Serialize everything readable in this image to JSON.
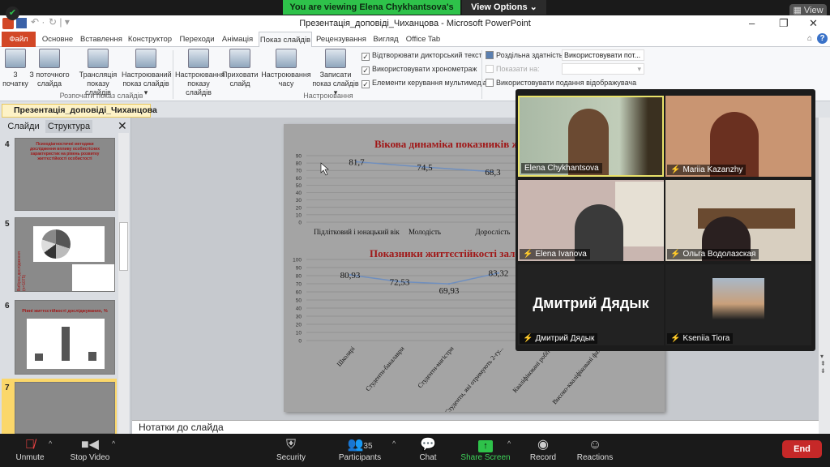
{
  "zoom": {
    "banner": "You are viewing Elena Chykhantsova's screen",
    "view_options": "View Options ⌄",
    "view": "View",
    "toolbar": {
      "unmute": "Unmute",
      "stop_video": "Stop Video",
      "security": "Security",
      "participants": "Participants",
      "participants_count": "35",
      "chat": "Chat",
      "share_screen": "Share Screen",
      "record": "Record",
      "reactions": "Reactions",
      "end": "End"
    },
    "participants": [
      {
        "name": "Elena Chykhantsova",
        "muted": false,
        "color": "#a9b9a5"
      },
      {
        "name": "Mariia Kazanzhy",
        "muted": true,
        "color": "#c99572"
      },
      {
        "name": "Elena Ivanova",
        "muted": true,
        "color": "#c9b6b0"
      },
      {
        "name": "Ольга Водолазская",
        "muted": true,
        "color": "#d8cfc0"
      },
      {
        "name": "Дмитрий Дядык",
        "muted": true,
        "big_name": "Дмитрий Дядык"
      },
      {
        "name": "Kseniia Tiora",
        "muted": true
      }
    ]
  },
  "ppt": {
    "title": "Презентація_доповіді_Чиханцова - Microsoft PowerPoint",
    "tabs": [
      "Файл",
      "Основне",
      "Вставлення",
      "Конструктор",
      "Переходи",
      "Анімація",
      "Показ слайдів",
      "Рецензування",
      "Вигляд",
      "Office Tab"
    ],
    "ribbon": {
      "buttons": [
        "3 початку",
        "З поточного слайда",
        "Трансляція показу слайдів",
        "Настроюваний показ слайдів ▾",
        "Настроювання показу слайдів",
        "Приховати слайд",
        "Настроювання часу",
        "Записати показ слайдів ▾"
      ],
      "groups": [
        "Розпочати показ слайдів",
        "Настроювання"
      ],
      "checks": [
        "Відтворювати дикторський текст",
        "Використовувати хронометраж",
        "Елементи керування мультимедіа"
      ],
      "resolution_label": "Роздільна здатність:",
      "resolution_value": "Використовувати пот...",
      "show_on_label": "Показати на:",
      "presenter_view": "Використовувати подання відображувача"
    },
    "doc_tab": "Презентація_доповіді_Чиханцова",
    "pane_tabs": [
      "Слайди",
      "Структура"
    ],
    "slide_numbers": [
      "4",
      "5",
      "6",
      "7"
    ],
    "thumb_titles": [
      "Психодіагностичні методики дослідження впливу особистісних характеристик на рівень розвитку життєстійкості особистості",
      "Вибірка дослідження (n=1075)",
      "Рівні життєстійкості досліджуваних, %"
    ],
    "notes": "Нотатки до слайда"
  },
  "chart_data": [
    {
      "type": "line",
      "title": "Вікова динаміка показників ж",
      "categories": [
        "Підлітковий і юнацький вік",
        "Молодість",
        "Дорослість"
      ],
      "values": [
        81.7,
        74.5,
        68.3
      ],
      "labels": [
        "81,7",
        "74,5",
        "68,3"
      ],
      "ylim": [
        0,
        90
      ],
      "yticks": [
        0,
        10,
        20,
        30,
        40,
        50,
        60,
        70,
        80,
        90
      ],
      "color": "#6f8fbf"
    },
    {
      "type": "line",
      "title": "Показники життєстійкості залежн",
      "categories": [
        "Школярі",
        "Студенти-бакалаври",
        "Студенти-магістри",
        "Студенти, які отримують 2-гу...",
        "Кваліфіковані робітн",
        "Високо-кваліфіковані фахі"
      ],
      "values": [
        80.93,
        72.53,
        69.93,
        83.32
      ],
      "labels": [
        "80,93",
        "72,53",
        "69,93",
        "83,32"
      ],
      "ylim": [
        0,
        100
      ],
      "yticks": [
        0,
        10,
        20,
        30,
        40,
        50,
        60,
        70,
        80,
        90,
        100
      ],
      "color": "#6f8fbf"
    }
  ]
}
